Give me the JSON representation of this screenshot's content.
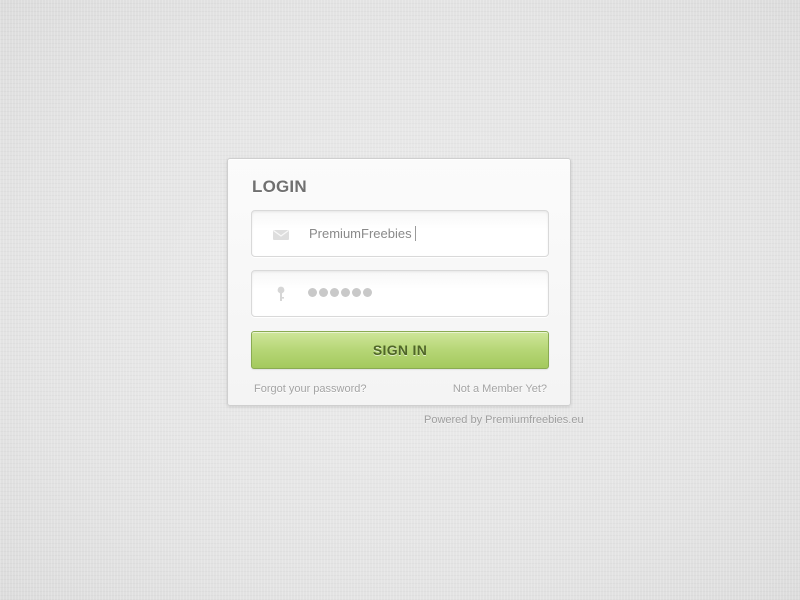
{
  "login": {
    "title": "LOGIN",
    "email_field": {
      "icon": "envelope-icon",
      "value": "PremiumFreebies"
    },
    "password_field": {
      "icon": "key-icon",
      "masked_length": 6
    },
    "sign_in_label": "SIGN IN",
    "forgot_link": "Forgot your password?",
    "member_link": "Not a Member Yet?"
  },
  "footer": {
    "powered_by": "Powered by Premiumfreebies.eu"
  },
  "colors": {
    "button_green": "#b6d676",
    "button_text": "#4f6627",
    "background": "#e5e5e5"
  }
}
